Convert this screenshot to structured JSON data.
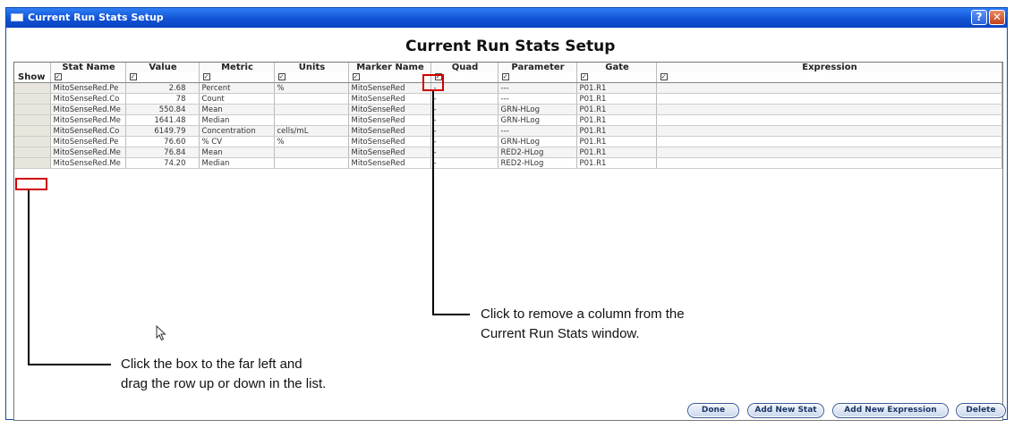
{
  "window": {
    "title": "Current Run Stats Setup"
  },
  "heading": "Current Run Stats Setup",
  "columns": [
    "Stat Name",
    "Value",
    "Metric",
    "Units",
    "Marker Name",
    "Quad",
    "Parameter",
    "Gate",
    "Expression"
  ],
  "show_label": "Show",
  "checkbox_mark": "✓",
  "rows": [
    {
      "stat": "MitoSenseRed.Pe",
      "value": "2.68",
      "metric": "Percent",
      "units": "%",
      "marker": "MitoSenseRed",
      "quad": "-",
      "param": "---",
      "gate": "P01.R1",
      "expr": ""
    },
    {
      "stat": "MitoSenseRed.Co",
      "value": "78",
      "metric": "Count",
      "units": "",
      "marker": "MitoSenseRed",
      "quad": "-",
      "param": "---",
      "gate": "P01.R1",
      "expr": ""
    },
    {
      "stat": "MitoSenseRed.Me",
      "value": "550.84",
      "metric": "Mean",
      "units": "",
      "marker": "MitoSenseRed",
      "quad": "-",
      "param": "GRN-HLog",
      "gate": "P01.R1",
      "expr": ""
    },
    {
      "stat": "MitoSenseRed.Me",
      "value": "1641.48",
      "metric": "Median",
      "units": "",
      "marker": "MitoSenseRed",
      "quad": "-",
      "param": "GRN-HLog",
      "gate": "P01.R1",
      "expr": ""
    },
    {
      "stat": "MitoSenseRed.Co",
      "value": "6149.79",
      "metric": "Concentration",
      "units": "cells/mL",
      "marker": "MitoSenseRed",
      "quad": "-",
      "param": "---",
      "gate": "P01.R1",
      "expr": ""
    },
    {
      "stat": "MitoSenseRed.Pe",
      "value": "76.60",
      "metric": "% CV",
      "units": "%",
      "marker": "MitoSenseRed",
      "quad": "-",
      "param": "GRN-HLog",
      "gate": "P01.R1",
      "expr": ""
    },
    {
      "stat": "MitoSenseRed.Me",
      "value": "76.84",
      "metric": "Mean",
      "units": "",
      "marker": "MitoSenseRed",
      "quad": "-",
      "param": "RED2-HLog",
      "gate": "P01.R1",
      "expr": ""
    },
    {
      "stat": "MitoSenseRed.Me",
      "value": "74.20",
      "metric": "Median",
      "units": "",
      "marker": "MitoSenseRed",
      "quad": "-",
      "param": "RED2-HLog",
      "gate": "P01.R1",
      "expr": ""
    }
  ],
  "callouts": {
    "remove_column": [
      "Click to remove a column from the",
      "Current Run Stats window."
    ],
    "drag_row": [
      "Click the box to the far left and",
      "drag the row up or down in the list."
    ]
  },
  "buttons": {
    "done": "Done",
    "add_stat": "Add New Stat",
    "add_expression": "Add New Expression",
    "delete": "Delete"
  },
  "colors": {
    "titlebar": "#1152d4",
    "callout_box": "#d10000"
  }
}
